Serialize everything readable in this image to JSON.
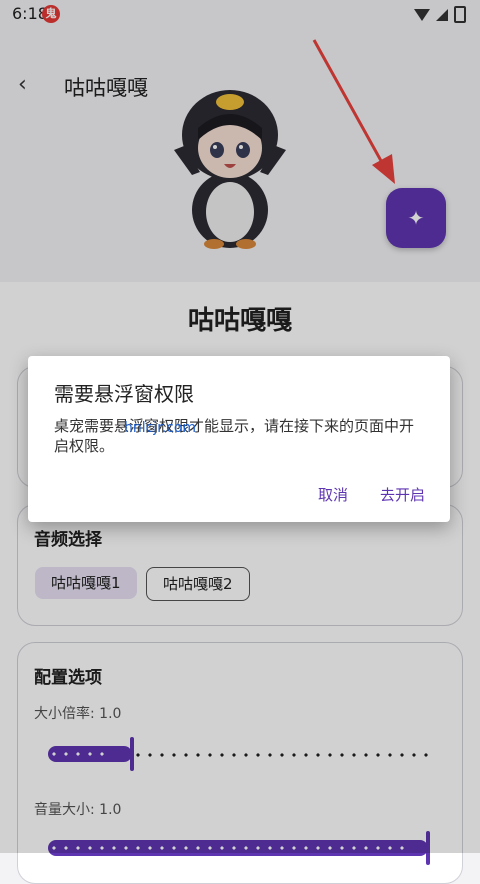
{
  "status_bar": {
    "time": "6:18",
    "badge": "鬼"
  },
  "header": {
    "back_icon": "‹",
    "title": "咕咕嘎嘎"
  },
  "fab": {
    "icon": "✦"
  },
  "pet_name": "咕咕嘎嘎",
  "audio_card": {
    "title": "音频选择",
    "options": [
      "咕咕嘎嘎1",
      "咕咕嘎嘎2"
    ],
    "selected": "咕咕嘎嘎1"
  },
  "config_card": {
    "title": "配置选项",
    "size_label": "大小倍率: 1.0",
    "size_fraction": 0.22,
    "volume_label": "音量大小: 1.0",
    "volume_fraction": 1.0
  },
  "dialog": {
    "title": "需要悬浮窗权限",
    "message": "桌宠需要悬浮窗权限才能显示，请在接下来的页面中开启权限。",
    "cancel": "取消",
    "confirm": "去开启"
  },
  "watermark": "hnlcjr.com",
  "colors": {
    "accent": "#5e35b1",
    "chip_selected": "#e7e0f3"
  }
}
